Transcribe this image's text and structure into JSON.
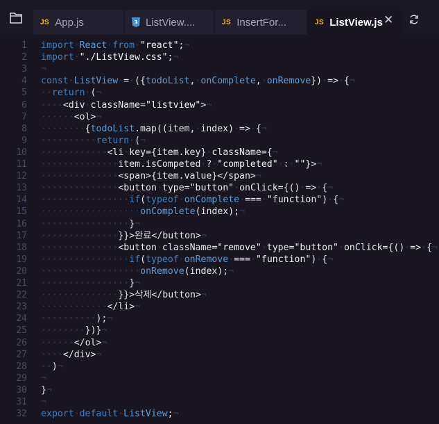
{
  "explorer_icon": "files-icon",
  "tabs": [
    {
      "lang": "JS",
      "label": "App.js",
      "active": false
    },
    {
      "lang": "CSS",
      "label": "ListView....",
      "active": false
    },
    {
      "lang": "JS",
      "label": "InsertFor...",
      "active": false
    },
    {
      "lang": "JS",
      "label": "ListView.js",
      "active": true
    }
  ],
  "close_icon": "close-icon",
  "refresh_icon": "refresh-icon",
  "colors": {
    "keyword": "#3f7fc0",
    "param": "#5b9bd5",
    "js_badge": "#f1c40f",
    "css_badge": "#3d8fe0",
    "background": "#191622"
  },
  "code_lines": [
    "import·React·from·\"react\";¬",
    "import·\"./ListView.css\";¬",
    "¬",
    "const·ListView·=·({todoList,·onComplete,·onRemove})·=>·{¬",
    "··return·(¬",
    "····<div·className=\"listview\">¬",
    "······<ol>¬",
    "········{todoList.map((item,·index)·=>·{¬",
    "··········return·(¬",
    "············<li·key={item.key}·className={¬",
    "··············item.isCompeted·?·\"completed\"·:·\"\"}>¬",
    "··············<span>{item.value}</span>¬",
    "··············<button·type=\"button\"·onClick={()·=>·{¬",
    "················if(typeof·onComplete·===·\"function\")·{¬",
    "··················onComplete(index);¬",
    "················}¬",
    "··············}}>완료</button>¬",
    "··············<button·className=\"remove\"·type=\"button\"·onClick={()·=>·{¬",
    "················if(typeof·onRemove·===·\"function\")·{¬",
    "··················onRemove(index);¬",
    "················}¬",
    "··············}}>삭제</button>¬",
    "············</li>¬",
    "··········);¬",
    "········})}¬",
    "······</ol>¬",
    "····</div>¬",
    "··)¬",
    "¬",
    "}¬",
    "¬",
    "export·default·ListView;¬"
  ]
}
